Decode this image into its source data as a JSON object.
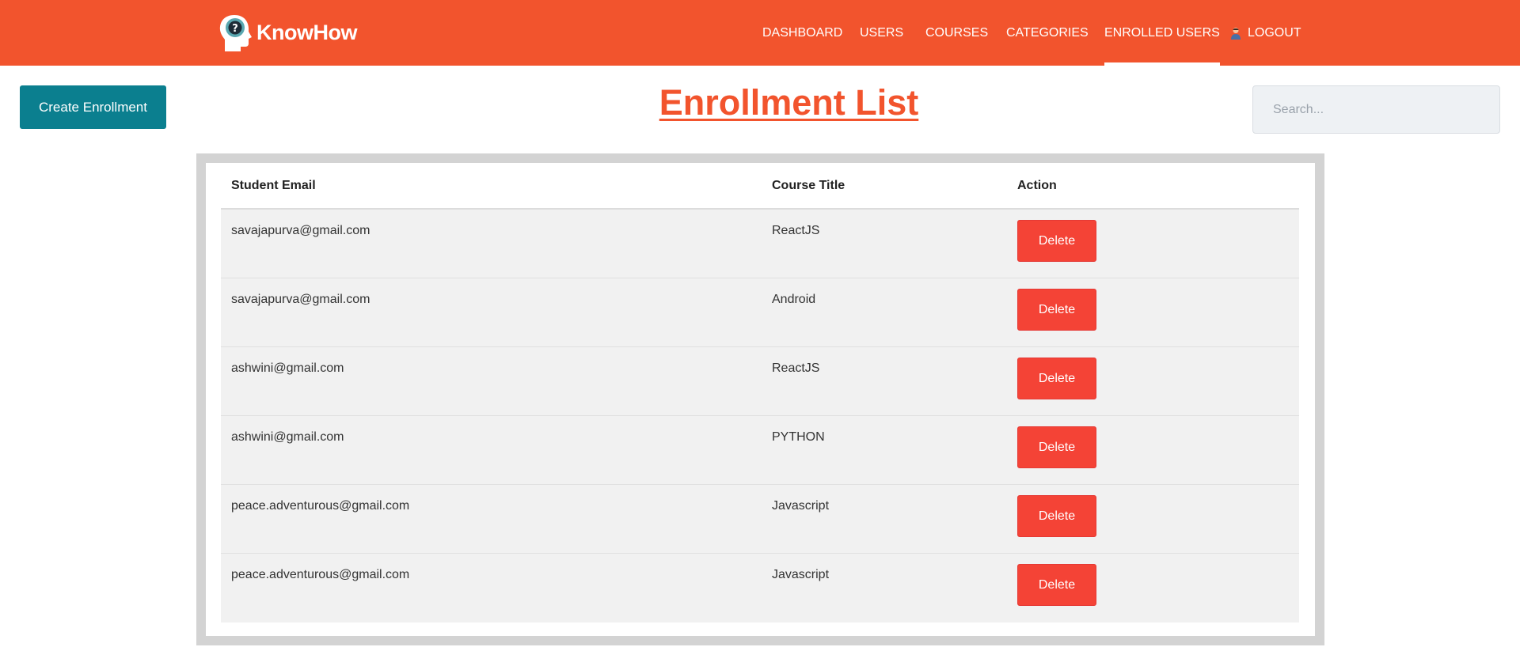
{
  "brand": {
    "name": "KnowHow"
  },
  "nav": {
    "items": [
      {
        "label": "DASHBOARD",
        "active": false
      },
      {
        "label": "USERS",
        "active": false
      },
      {
        "label": "COURSES",
        "active": false
      },
      {
        "label": "CATEGORIES",
        "active": false
      },
      {
        "label": "ENROLLED USERS",
        "active": true
      },
      {
        "label": "LOGOUT",
        "active": false
      }
    ]
  },
  "toolbar": {
    "create_label": "Create Enrollment",
    "title": "Enrollment List",
    "search_placeholder": "Search..."
  },
  "table": {
    "headers": [
      "Student Email",
      "Course Title",
      "Action"
    ],
    "delete_label": "Delete",
    "rows": [
      {
        "email": "savajapurva@gmail.com",
        "course": "ReactJS"
      },
      {
        "email": "savajapurva@gmail.com",
        "course": "Android"
      },
      {
        "email": "ashwini@gmail.com",
        "course": "ReactJS"
      },
      {
        "email": "ashwini@gmail.com",
        "course": "PYTHON"
      },
      {
        "email": "peace.adventurous@gmail.com",
        "course": "Javascript"
      },
      {
        "email": "peace.adventurous@gmail.com",
        "course": "Javascript"
      }
    ]
  },
  "colors": {
    "header_bg": "#f2542d",
    "primary_button": "#0b7f8f",
    "danger_button": "#f44336",
    "title": "#f2542d"
  },
  "icons": {
    "logo": "head-question-icon",
    "logout": "user-icon"
  }
}
